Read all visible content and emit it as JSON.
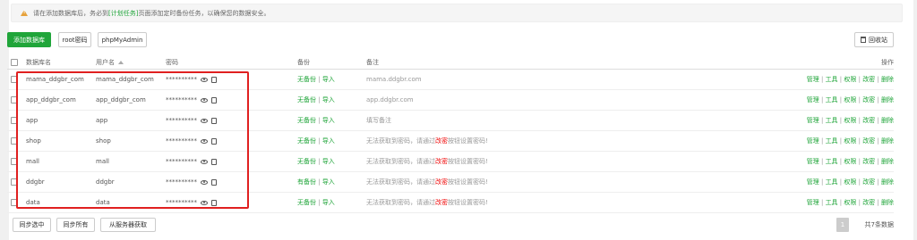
{
  "notice": {
    "prefix": "请在添加数据库后，务必到",
    "link": "[计划任务]",
    "suffix": "页面添加定时备份任务，以确保您的数据安全。"
  },
  "toolbar": {
    "add_db": "添加数据库",
    "root_pwd": "root密码",
    "phpmyadmin": "phpMyAdmin",
    "recycle": "回收站"
  },
  "table": {
    "headers": {
      "name": "数据库名",
      "user": "用户名",
      "pwd": "密码",
      "backup": "备份",
      "note": "备注",
      "ops": "操作"
    },
    "rows": [
      {
        "name": "mama_ddgbr_com",
        "user": "mama_ddgbr_com",
        "pwd": "**********",
        "backup": "无备份",
        "import": "导入",
        "note": "mama.ddgbr.com"
      },
      {
        "name": "app_ddgbr_com",
        "user": "app_ddgbr_com",
        "pwd": "**********",
        "backup": "无备份",
        "import": "导入",
        "note": "app.ddgbr.com"
      },
      {
        "name": "app",
        "user": "app",
        "pwd": "**********",
        "backup": "无备份",
        "import": "导入",
        "note": "填写备注"
      },
      {
        "name": "shop",
        "user": "shop",
        "pwd": "**********",
        "backup": "无备份",
        "import": "导入",
        "note_pre": "无法获取到密码，请通过",
        "note_red": "改密",
        "note_post": "按钮设置密码!"
      },
      {
        "name": "mall",
        "user": "mall",
        "pwd": "**********",
        "backup": "无备份",
        "import": "导入",
        "note_pre": "无法获取到密码，请通过",
        "note_red": "改密",
        "note_post": "按钮设置密码!"
      },
      {
        "name": "ddgbr",
        "user": "ddgbr",
        "pwd": "**********",
        "backup": "有备份",
        "import": "导入",
        "note_pre": "无法获取到密码，请通过",
        "note_red": "改密",
        "note_post": "按钮设置密码!"
      },
      {
        "name": "data",
        "user": "data",
        "pwd": "**********",
        "backup": "无备份",
        "import": "导入",
        "note_pre": "无法获取到密码，请通过",
        "note_red": "改密",
        "note_post": "按钮设置密码!"
      }
    ],
    "ops": {
      "manage": "管理",
      "tools": "工具",
      "perms": "权限",
      "change_pwd": "改密",
      "delete": "删除"
    }
  },
  "footer": {
    "sync_selected": "同步选中",
    "sync_all": "同步所有",
    "fetch_server": "从服务器获取",
    "page": "1",
    "total": "共7条数据"
  },
  "colors": {
    "accent": "#20a53a",
    "highlight": "#e02020",
    "warning": "#e6a23c",
    "danger": "#ef0808"
  }
}
